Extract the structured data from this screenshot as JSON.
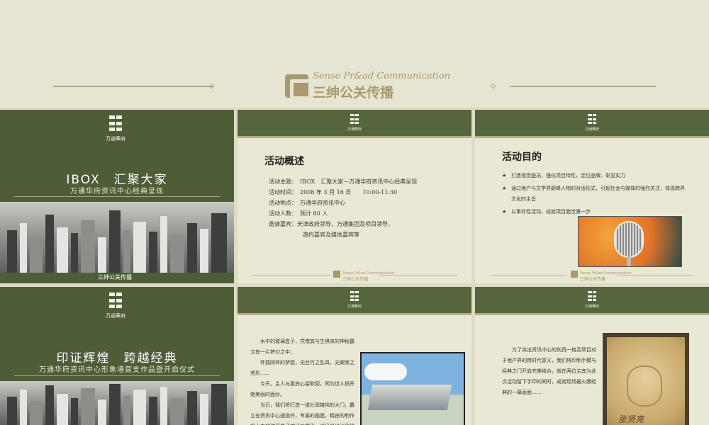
{
  "banner": {
    "brand_en": "Sense Pr&ad Communication",
    "brand_cn": "三绅公关传播",
    "ornament": "⟡"
  },
  "project_logo": {
    "name": "万通華府"
  },
  "footer_brand": {
    "en": "Sense Pr&ad Communication",
    "cn": "三绅公关传播"
  },
  "slides": [
    {
      "type": "cover",
      "title": "IBOX　汇聚大家",
      "subtitle": "万通华府资讯中心经典呈现"
    },
    {
      "type": "overview",
      "title": "活动概述",
      "rows": [
        "活动主题：　IBOX　汇聚大家—万通华府资讯中心经典呈现",
        "活动时间：　2008 年 3 月 16 日　　10:00-11:30",
        "活动地点：　万通华府资讯中心",
        "活动人数：　预计 80 人",
        "邀请嘉宾：天津政府领导、万通集团及项目领导，"
      ],
      "row_cont": "邀约嘉宾及媒体嘉宾等"
    },
    {
      "type": "purpose",
      "title": "活动目的",
      "bullet_symbol": "★",
      "bullets": [
        "打造视觉盛况，强化项目特性，定位品牌，彰显实力",
        "通过地产与文学界巅峰人物的对话形式，引起社会与媒体的强烈关注，体现跨界文化的主旨",
        "以事件性活动，成就项目面世第一步"
      ]
    },
    {
      "type": "cover",
      "title": "印证辉煌　跨越经典",
      "subtitle": "万通华府资讯中心形象墙首支作品暨开启仪式"
    },
    {
      "type": "text-photo",
      "paragraphs": [
        "水中的玻璃盒子，凭借其与生俱来的神秘矗立在一片梦幻之中；",
        "怀揣同样的梦想，无丝竹之乱耳，无案牍之劳形……",
        "今天，主人与嘉宾心留默契，同为世人揭开她美丽的面纱。",
        "当日，我们将打造一道壮观雄伟的大门，矗立在资讯中心通道外，专属的画面，精良的制作将水中的玻璃盒子神秘气质用一道风景线诠释得更具划时代的意义。"
      ]
    },
    {
      "type": "text-photo",
      "paragraphs": [
        "为了突出资讯中心的别具一格及项目对于地产界的跨时代意义，我们将印制手模与经典之门开启完美结合，就在两位主宾为此次活动留下手印的同时，成就现场最火爆经典的一幕画面……"
      ],
      "signature": "张贤亮"
    }
  ]
}
